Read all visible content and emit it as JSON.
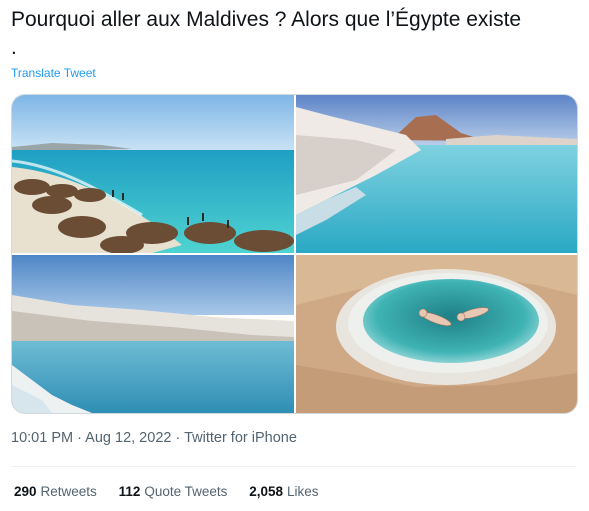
{
  "tweet": {
    "text": "Pourquoi aller aux Maldives ? Alors que l’Égypte existe\n.",
    "translate_label": "Translate Tweet"
  },
  "media": {
    "photos": [
      {
        "subject": "beach-with-parasols"
      },
      {
        "subject": "salt-lake-with-hill"
      },
      {
        "subject": "turquoise-lake-with-salt-shore"
      },
      {
        "subject": "salt-pool-with-swimmers"
      }
    ]
  },
  "meta": {
    "time": "10:01 PM",
    "sep1": " · ",
    "date": "Aug 12, 2022",
    "sep2": " · ",
    "client": "Twitter for iPhone"
  },
  "stats": {
    "retweets": {
      "count": "290",
      "label": "Retweets"
    },
    "quotes": {
      "count": "112",
      "label": "Quote Tweets"
    },
    "likes": {
      "count": "2,058",
      "label": "Likes"
    }
  },
  "colors": {
    "link": "#1d9bf0",
    "secondary_text": "#536471",
    "primary_text": "#0f1419",
    "border": "#cfd9de"
  }
}
